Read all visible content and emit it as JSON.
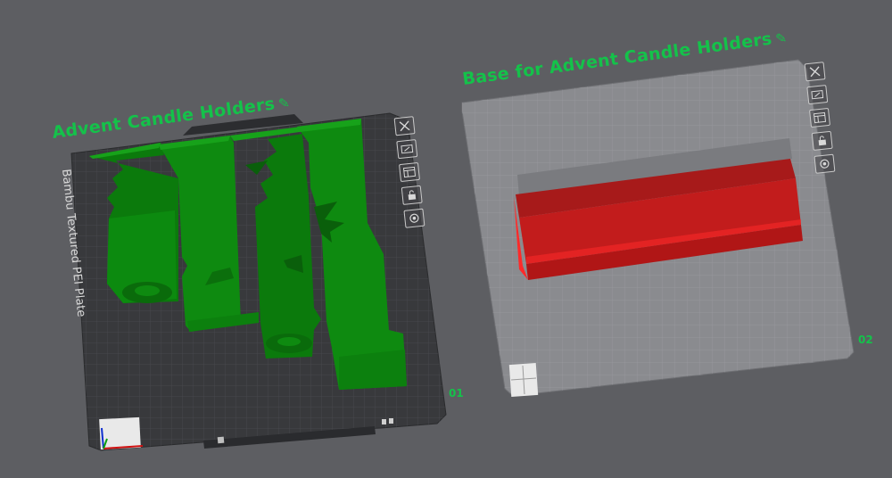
{
  "colors": {
    "background": "#5d5e62",
    "title_green": "#14c24a",
    "plate_number_green": "#14c24a",
    "model_green": "#0e8a10",
    "model_red": "#c51b1b",
    "plate_dark": "#3a3b3e",
    "plate_light": "#88898d"
  },
  "plates": [
    {
      "title": "Advent Candle Holders",
      "number": "01",
      "bed_label": "Bambu Textured PEI Plate",
      "model_color": "green",
      "edit_icon": "pencil-icon",
      "toolbar_icons": [
        "close-icon",
        "auto-arrange-icon",
        "layout-icon",
        "lock-icon",
        "settings-gear-icon"
      ]
    },
    {
      "title": "Base for Advent Candle Holders",
      "number": "02",
      "model_color": "red",
      "edit_icon": "pencil-icon",
      "toolbar_icons": [
        "close-icon",
        "auto-arrange-icon",
        "layout-icon",
        "lock-icon",
        "settings-gear-icon"
      ]
    }
  ]
}
